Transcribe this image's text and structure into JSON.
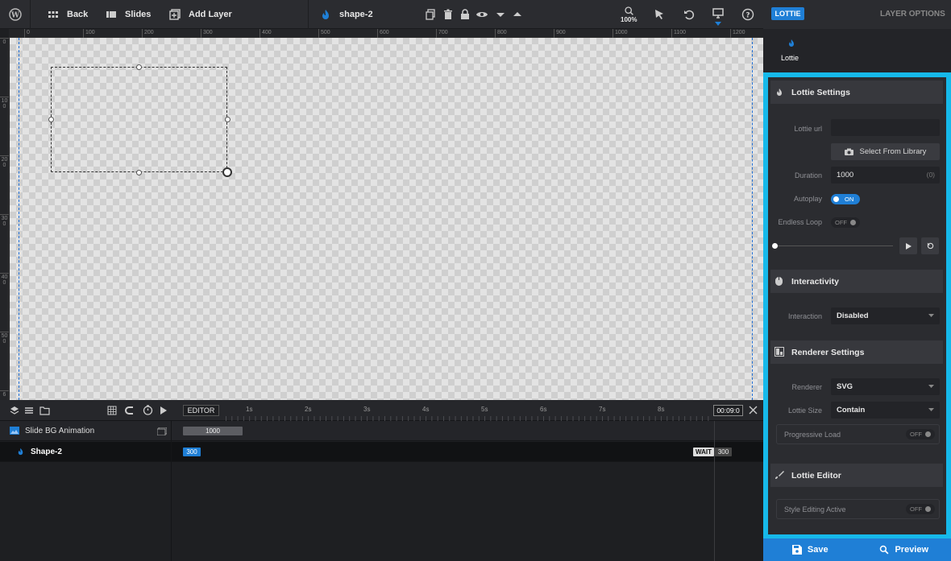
{
  "toolbar": {
    "back_label": "Back",
    "slides_label": "Slides",
    "add_layer_label": "Add Layer",
    "layer_name": "shape-2",
    "zoom": "100%"
  },
  "ruler": {
    "top_ticks": [
      "0",
      "100",
      "200",
      "300",
      "400",
      "500",
      "600",
      "700",
      "800",
      "900",
      "1000",
      "1100",
      "1200"
    ],
    "left_ticks": [
      "0",
      "100",
      "200",
      "300",
      "400",
      "500",
      "6"
    ]
  },
  "timeline": {
    "editor_label": "EDITOR",
    "seconds": [
      "1s",
      "2s",
      "3s",
      "4s",
      "5s",
      "6s",
      "7s",
      "8s"
    ],
    "time_readout": "00:09:0",
    "rows": [
      {
        "name": "Slide BG Animation",
        "duration": "1000"
      },
      {
        "name": "Shape-2",
        "duration": "300",
        "wait_label": "WAIT",
        "wait_value": "300"
      }
    ]
  },
  "sidebar": {
    "badge": "LOTTIE",
    "layer_options": "LAYER OPTIONS",
    "tab_label": "Lottie",
    "lottie_settings": {
      "title": "Lottie Settings",
      "url_label": "Lottie url",
      "url_value": "",
      "library_button": "Select From Library",
      "duration_label": "Duration",
      "duration_value": "1000",
      "duration_hint": "(0)",
      "autoplay_label": "Autoplay",
      "autoplay_state": "ON",
      "loop_label": "Endless Loop",
      "loop_state": "OFF"
    },
    "interactivity": {
      "title": "Interactivity",
      "interaction_label": "Interaction",
      "interaction_value": "Disabled"
    },
    "renderer": {
      "title": "Renderer Settings",
      "renderer_label": "Renderer",
      "renderer_value": "SVG",
      "size_label": "Lottie Size",
      "size_value": "Contain",
      "progressive_label": "Progressive Load",
      "progressive_state": "OFF"
    },
    "editor": {
      "title": "Lottie Editor",
      "style_label": "Style Editing Active",
      "style_state": "OFF"
    },
    "save_label": "Save",
    "preview_label": "Preview"
  },
  "colors": {
    "accent": "#1f7fd6",
    "highlight_frame": "#16b9ea"
  }
}
